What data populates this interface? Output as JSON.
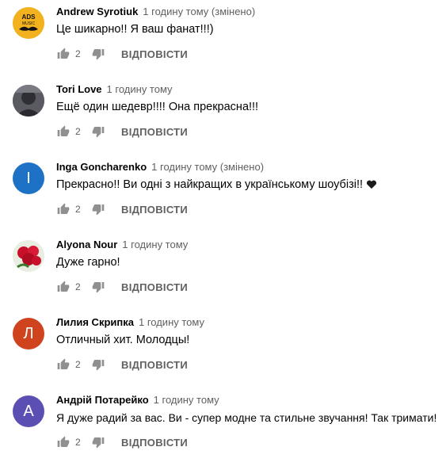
{
  "reply_label": "ВІДПОВІСТИ",
  "comments": [
    {
      "author": "Andrew Syrotiuk",
      "time": "1 годину тому (змінено)",
      "text": "Це шикарно!! Я ваш фанат!!!)",
      "likes": "2",
      "avatar_text": "ADS MUSIC",
      "avatar_color": "#f2b21f"
    },
    {
      "author": "Tori Love",
      "time": "1 годину тому",
      "text": "Ещё один шедевр!!!! Она прекрасна!!!",
      "likes": "2",
      "avatar_color": "#4a4a52"
    },
    {
      "author": "Inga Goncharenko",
      "time": "1 годину тому (змінено)",
      "text": "Прекрасно!! Ви одні з найкращих в українському шоубізі!!",
      "likes": "2",
      "avatar_letter": "I",
      "avatar_color": "#1e72c6"
    },
    {
      "author": "Alyona Nour",
      "time": "1 годину тому",
      "text": "Дуже гарно!",
      "likes": "2",
      "avatar_color": "#c9102a"
    },
    {
      "author": "Лилия Скрипка",
      "time": "1 годину тому",
      "text": "Отличный хит. Молодцы!",
      "likes": "2",
      "avatar_letter": "Л",
      "avatar_color": "#d0431f"
    },
    {
      "author": "Андрій Потарейко",
      "time": "1 годину тому",
      "text": "Я дуже радий за вас. Ви - супер модне та стильне  звучання! Так тримати!",
      "likes": "2",
      "avatar_letter": "A",
      "avatar_color": "#5c4fb3"
    }
  ]
}
